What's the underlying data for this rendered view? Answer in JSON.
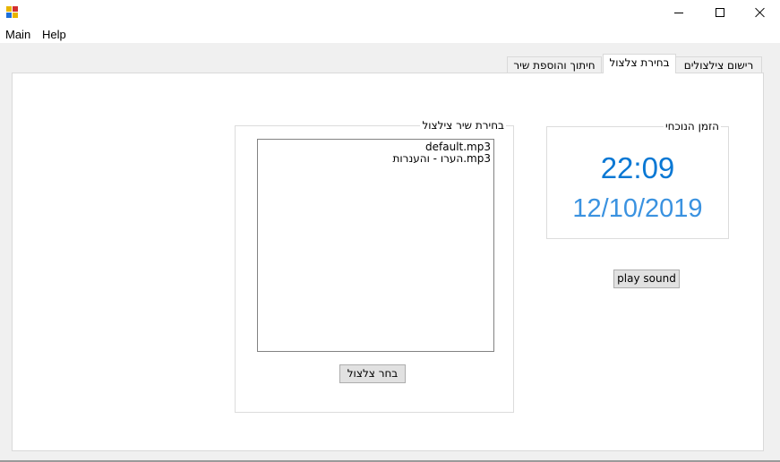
{
  "window": {
    "icon": "winforms-app-icon",
    "controls": {
      "minimize": "minimize-icon",
      "maximize": "maximize-icon",
      "close": "close-icon"
    }
  },
  "menu": {
    "items": [
      "Main",
      "Help"
    ]
  },
  "tabs": [
    {
      "label": "חיתוך והוספת שיר",
      "active": false
    },
    {
      "label": "בחירת צלצול",
      "active": true
    },
    {
      "label": "רישום צילצולים",
      "active": false
    }
  ],
  "song_group": {
    "legend": "בחירת שיר צילצול",
    "items": [
      "default.mp3",
      "הערו - והענרות.mp3"
    ],
    "choose_button": "בחר צלצול"
  },
  "time_group": {
    "legend": "הזמן הנוכחי",
    "time": "22:09",
    "date": "12/10/2019"
  },
  "play_button": "play sound",
  "colors": {
    "time": "#0a78d4",
    "date": "#3a92e0",
    "window_bg": "#f0f0f0",
    "panel_bg": "#ffffff",
    "button_bg": "#e1e1e1"
  }
}
